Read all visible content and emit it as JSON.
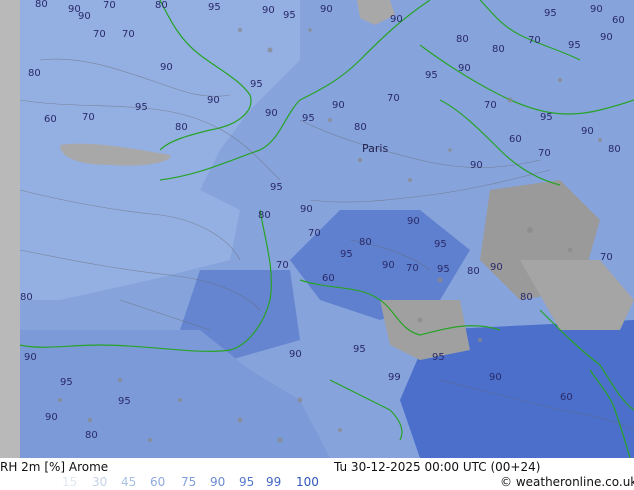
{
  "map": {
    "city_label": "Paris",
    "contour_labels": [
      "80",
      "90",
      "70",
      "80",
      "90",
      "95",
      "90",
      "95",
      "90",
      "70",
      "70",
      "80",
      "60",
      "70",
      "80",
      "90",
      "95",
      "90",
      "80",
      "95",
      "90",
      "95",
      "80",
      "90",
      "95",
      "90",
      "95",
      "90",
      "80",
      "70",
      "95",
      "90",
      "80",
      "70",
      "95",
      "90",
      "60",
      "90",
      "95",
      "90",
      "80",
      "70",
      "95",
      "90",
      "80",
      "70",
      "60",
      "90",
      "95",
      "90",
      "80",
      "70",
      "95",
      "90",
      "70",
      "95",
      "80",
      "90",
      "95",
      "90",
      "80",
      "70",
      "60",
      "90",
      "95",
      "99",
      "95",
      "90",
      "80",
      "70",
      "60"
    ]
  },
  "legend": {
    "title": "RH 2m [%] Arome",
    "datetime": "Tu 30-12-2025 00:00 UTC (00+24)",
    "credit": "© weatheronline.co.uk",
    "scale": [
      {
        "label": "15",
        "color": "#e0e7f3"
      },
      {
        "label": "30",
        "color": "#c5d3ea"
      },
      {
        "label": "45",
        "color": "#a9c0e2"
      },
      {
        "label": "60",
        "color": "#8eaadc"
      },
      {
        "label": "75",
        "color": "#7f9fd8"
      },
      {
        "label": "90",
        "color": "#6a8bd2"
      },
      {
        "label": "95",
        "color": "#5577cc"
      },
      {
        "label": "99",
        "color": "#4066c3"
      },
      {
        "label": "100",
        "color": "#2f56b9"
      }
    ]
  }
}
